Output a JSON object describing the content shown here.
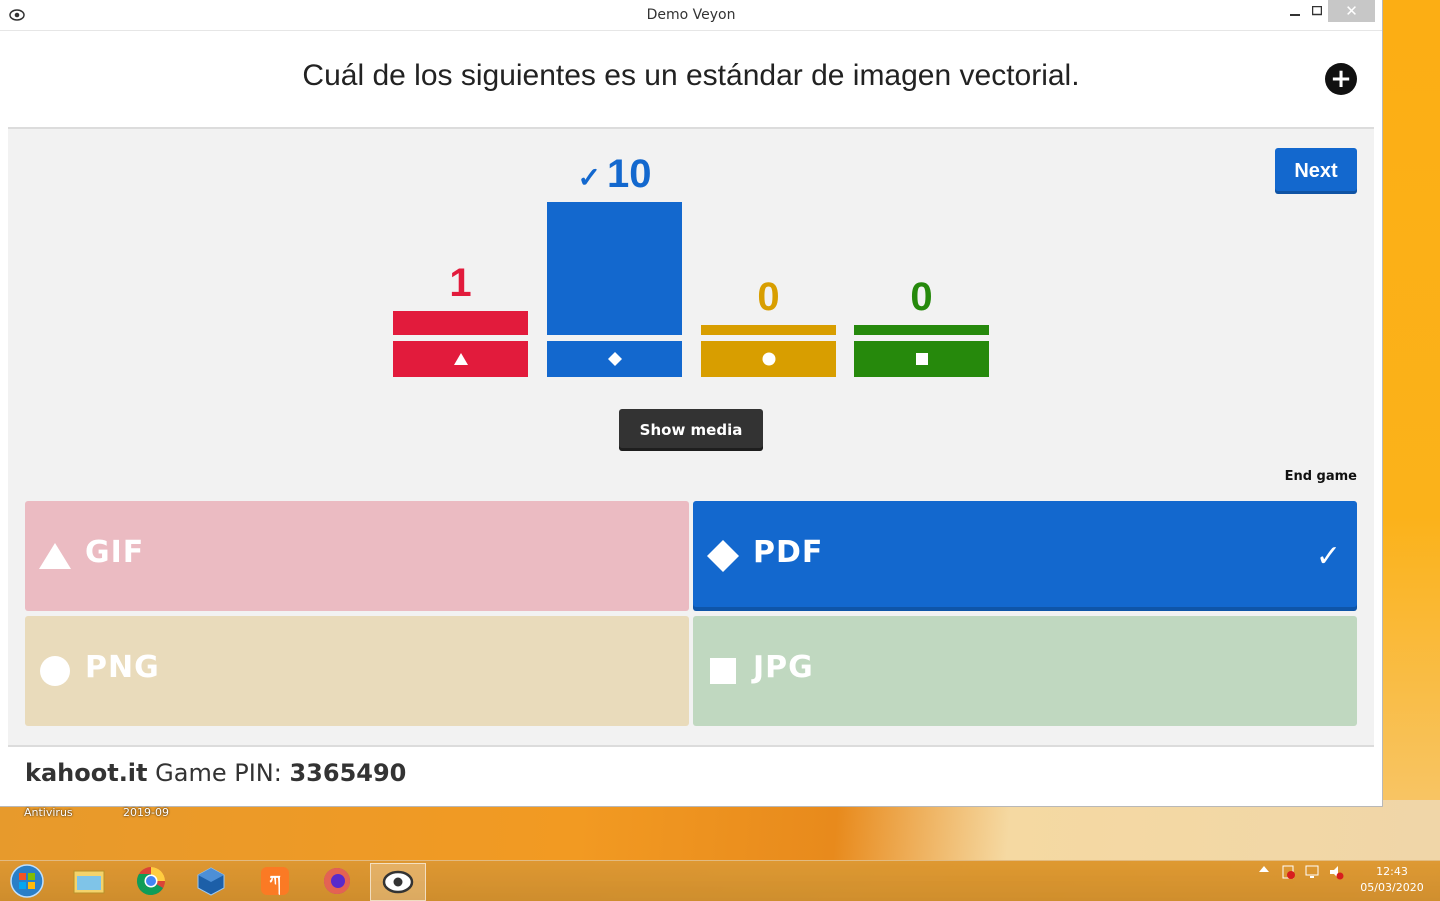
{
  "window": {
    "title": "Demo Veyon",
    "close_label": "✕",
    "min_label": "▁",
    "max_label": "□"
  },
  "question": {
    "text": "Cuál de los siguientes es un estándar de imagen vectorial.",
    "plus_label": "+"
  },
  "next_label": "Next",
  "chart_data": {
    "type": "bar",
    "categories": [
      "triangle",
      "diamond",
      "circle",
      "square"
    ],
    "values": [
      1,
      10,
      0,
      0
    ],
    "correct_index": 1,
    "colors": [
      "#e21b3c",
      "#1368ce",
      "#d89e00",
      "#26890c"
    ]
  },
  "counts": {
    "c0": "1",
    "c1": "10",
    "c2": "0",
    "c3": "0",
    "check": "✓"
  },
  "show_media_label": "Show media",
  "end_game_label": "End game",
  "answers": [
    {
      "label": "GIF",
      "shape": "triangle-icon",
      "correct": false,
      "color": "#ebbbc2"
    },
    {
      "label": "PDF",
      "shape": "diamond-icon",
      "correct": true,
      "color": "#1368ce"
    },
    {
      "label": "PNG",
      "shape": "circle-icon",
      "correct": false,
      "color": "#e9dbbb"
    },
    {
      "label": "JPG",
      "shape": "square-icon",
      "correct": false,
      "color": "#c0d8c0"
    }
  ],
  "footer": {
    "site": "kahoot.it",
    "pin_label": "Game PIN:",
    "pin": "3365490"
  },
  "desktop": {
    "label1": "Antivirus",
    "label2": "2019-09"
  },
  "taskbar": {
    "time": "12:43",
    "date": "05/03/2020"
  }
}
